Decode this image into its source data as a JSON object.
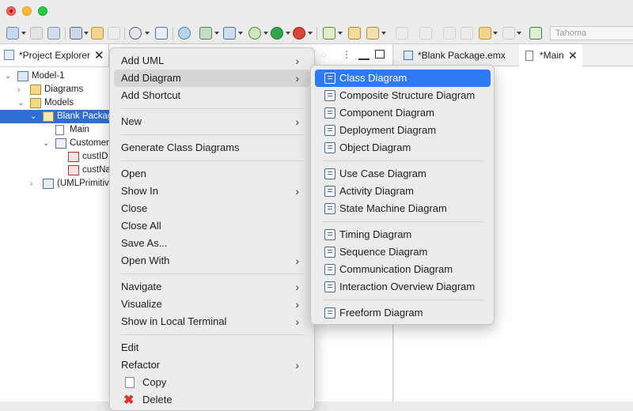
{
  "toolbar": {
    "font_name": "Tahoma"
  },
  "project_explorer": {
    "tab_label": "*Project Explorer",
    "tree": [
      {
        "label": "Model-1",
        "twisty": "⌄",
        "indent": 0,
        "icon": "model-icon"
      },
      {
        "label": "Diagrams",
        "twisty": "›",
        "indent": 1,
        "icon": "diagrams-folder-icon"
      },
      {
        "label": "Models",
        "twisty": "⌄",
        "indent": 1,
        "icon": "models-folder-icon"
      },
      {
        "label": "Blank Package",
        "twisty": "⌄",
        "indent": 2,
        "icon": "package-icon",
        "selected": true
      },
      {
        "label": "Main",
        "twisty": "",
        "indent": 3,
        "icon": "diagram-file-icon"
      },
      {
        "label": "Customer",
        "twisty": "⌄",
        "indent": 3,
        "icon": "class-icon"
      },
      {
        "label": "custID",
        "twisty": "",
        "indent": 4,
        "icon": "attribute-icon"
      },
      {
        "label": "custName",
        "twisty": "",
        "indent": 4,
        "icon": "attribute-icon"
      },
      {
        "label": "(UMLPrimitiveTypes)",
        "twisty": "›",
        "indent": 2,
        "icon": "import-icon"
      }
    ]
  },
  "editor": {
    "tabs": [
      {
        "label": "*Blank Package.emx"
      },
      {
        "label": "*Main",
        "close": "✕"
      }
    ]
  },
  "context_menu": {
    "items": [
      {
        "label": "Add UML",
        "submenu": true
      },
      {
        "label": "Add Diagram",
        "submenu": true,
        "hover": true
      },
      {
        "label": "Add Shortcut"
      },
      {
        "sep": true
      },
      {
        "label": "New",
        "submenu": true
      },
      {
        "sep": true
      },
      {
        "label": "Generate Class Diagrams"
      },
      {
        "sep": true
      },
      {
        "label": "Open"
      },
      {
        "label": "Show In",
        "submenu": true
      },
      {
        "label": "Close"
      },
      {
        "label": "Close All"
      },
      {
        "label": "Save As..."
      },
      {
        "label": "Open With",
        "submenu": true
      },
      {
        "sep": true
      },
      {
        "label": "Navigate",
        "submenu": true
      },
      {
        "label": "Visualize",
        "submenu": true
      },
      {
        "label": "Show in Local Terminal",
        "submenu": true
      },
      {
        "sep": true
      },
      {
        "label": "Edit"
      },
      {
        "label": "Refactor",
        "submenu": true
      },
      {
        "label": "Copy",
        "icon": "copy-icon"
      },
      {
        "label": "Delete",
        "icon": "delete-icon"
      }
    ]
  },
  "diagram_submenu": {
    "items": [
      {
        "label": "Class Diagram",
        "selected": true
      },
      {
        "label": "Composite Structure Diagram"
      },
      {
        "label": "Component Diagram"
      },
      {
        "label": "Deployment Diagram"
      },
      {
        "label": "Object Diagram"
      },
      {
        "sep": true
      },
      {
        "label": "Use Case Diagram"
      },
      {
        "label": "Activity Diagram"
      },
      {
        "label": "State Machine Diagram"
      },
      {
        "sep": true
      },
      {
        "label": "Timing Diagram"
      },
      {
        "label": "Sequence Diagram"
      },
      {
        "label": "Communication Diagram"
      },
      {
        "label": "Interaction Overview Diagram"
      },
      {
        "sep": true
      },
      {
        "label": "Freeform Diagram"
      }
    ]
  },
  "colors": {
    "selection": "#2f7af5",
    "tree_selection": "#2f6ed6"
  }
}
